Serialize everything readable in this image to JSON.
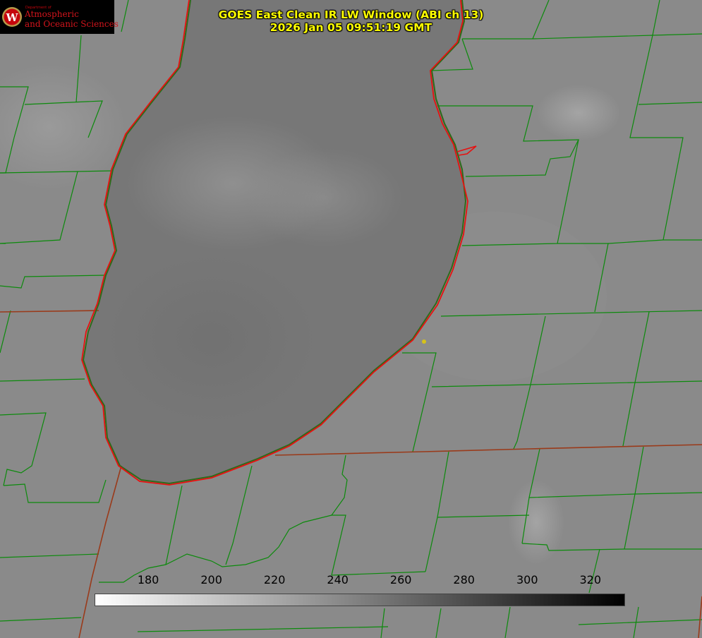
{
  "header": {
    "logo": {
      "department": "Department of",
      "line1": "Atmospheric",
      "line2": "and Oceanic Sciences",
      "seal_letter": "W"
    },
    "title_line1": "GOES East Clean IR LW Window (ABI ch 13)",
    "title_line2": "2026 Jan 05 09:51:19 GMT"
  },
  "map": {
    "county_line_color": "#0c8a0c",
    "state_line_color": "#9a3a1a",
    "lake_shoreline_color": "#e81010",
    "location_marker_color": "#d6c21a",
    "lake_color": "#767676",
    "land_color": "#8c8c8c"
  },
  "colorbar": {
    "tick_labels": [
      "180",
      "200",
      "220",
      "240",
      "260",
      "280",
      "300",
      "320"
    ],
    "min": 163,
    "max": 331,
    "gradient_start": "#ffffff",
    "gradient_end": "#000000"
  }
}
